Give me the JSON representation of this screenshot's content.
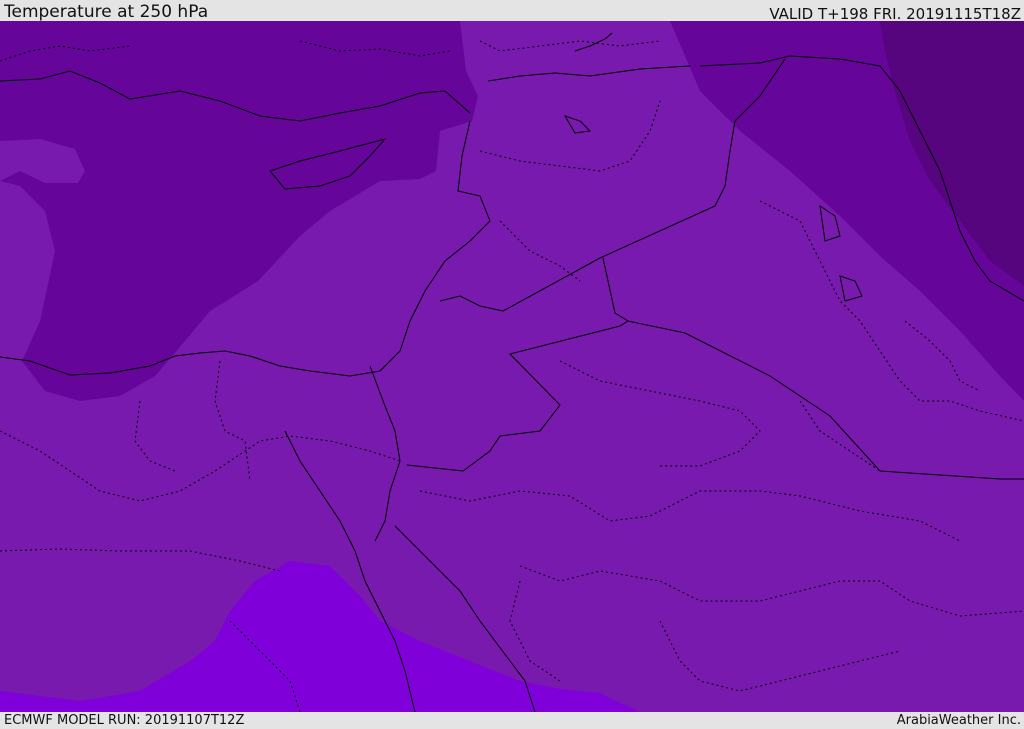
{
  "header": {
    "title": "Temperature at 250 hPa",
    "valid": "VALID T+198 FRI. 20191115T18Z"
  },
  "footer": {
    "model_run": "ECMWF MODEL RUN: 20191107T12Z",
    "credit": "ArabiaWeather Inc."
  },
  "map": {
    "field": "temperature",
    "level": "250 hPa",
    "colors": {
      "background": "#781aad",
      "dark_band": "#65059a",
      "darker_band": "#56057e",
      "warm_patch": "#7f00d8",
      "coastline": "#000000",
      "borders": "#000000"
    }
  }
}
